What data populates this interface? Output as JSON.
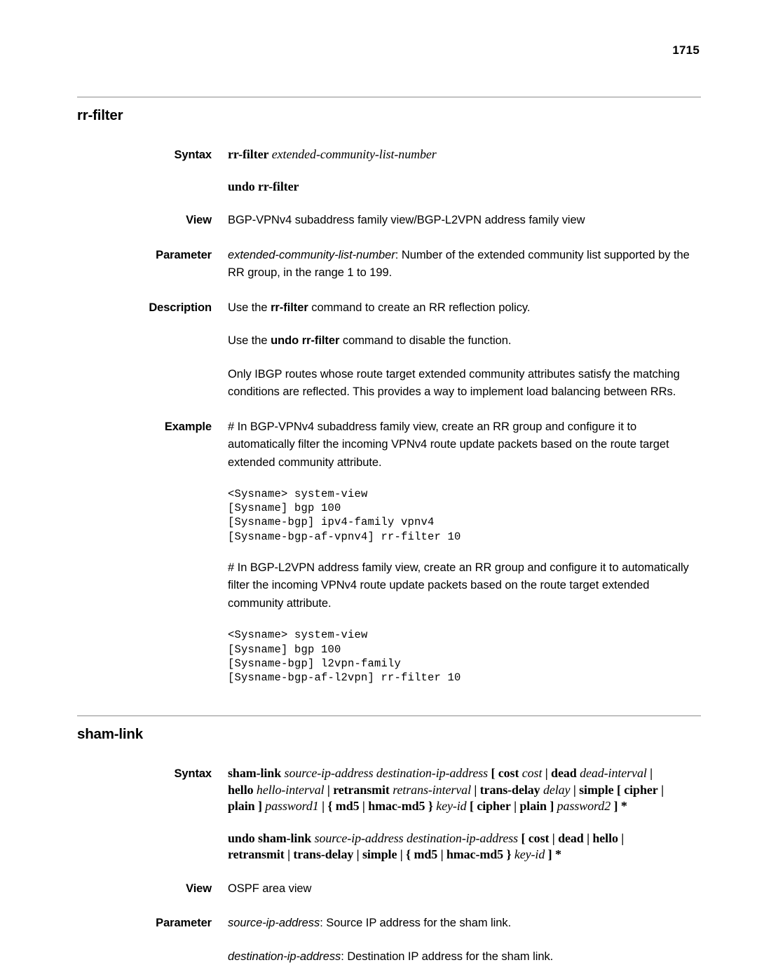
{
  "page": {
    "number": "1715"
  },
  "sections": [
    {
      "id": "rr-filter",
      "title": "rr-filter",
      "rows": [
        {
          "label": "Syntax",
          "syntax_lines": [
            "rr-filter extended-community-list-number",
            "undo rr-filter"
          ]
        },
        {
          "label": "View",
          "text": "BGP-VPNv4 subaddress family view/BGP-L2VPN address family view"
        },
        {
          "label": "Parameter",
          "param_name": "extended-community-list-number",
          "text": ": Number of the extended community list supported by the RR group, in the range 1 to 199."
        },
        {
          "label": "Description",
          "paragraphs": [
            {
              "pre": "Use the ",
              "bold": "rr-filter",
              "post": " command to create an RR reflection policy."
            },
            {
              "pre": "Use the ",
              "bold": "undo rr-filter",
              "post": " command to disable the function."
            },
            {
              "pre": "Only IBGP routes whose route target extended community attributes satisfy the matching conditions are reflected. This provides a way to implement load balancing between RRs.",
              "bold": "",
              "post": ""
            }
          ]
        },
        {
          "label": "Example",
          "example_1_text": "# In BGP-VPNv4 subaddress family view, create an RR group and configure it to automatically filter the incoming VPNv4 route update packets based on the route target extended community attribute.",
          "example_1_code": "<Sysname> system-view\n[Sysname] bgp 100\n[Sysname-bgp] ipv4-family vpnv4\n[Sysname-bgp-af-vpnv4] rr-filter 10",
          "example_2_text": "# In BGP-L2VPN address family view, create an RR group and configure it to automatically filter the incoming VPNv4 route update packets based on the route target extended community attribute.",
          "example_2_code": "<Sysname> system-view\n[Sysname] bgp 100\n[Sysname-bgp] l2vpn-family\n[Sysname-bgp-af-l2vpn] rr-filter 10"
        }
      ]
    },
    {
      "id": "sham-link",
      "title": "sham-link",
      "rows": [
        {
          "label": "Syntax"
        },
        {
          "label": "View",
          "text": "OSPF area view"
        },
        {
          "label": "Parameter",
          "param_1_name": "source-ip-address",
          "param_1_text": ": Source IP address for the sham link.",
          "param_2_name": "destination-ip-address",
          "param_2_text": ": Destination IP address for the sham link."
        }
      ]
    }
  ],
  "labels": {
    "syntax": "Syntax",
    "view": "View",
    "parameter": "Parameter",
    "description": "Description",
    "example": "Example"
  },
  "sham_link_syntax": {
    "cmd": "sham-link",
    "undo_cmd": "undo sham-link",
    "src": "source-ip-address",
    "dst": "destination-ip-address",
    "cost_kw": "cost",
    "cost_var": "cost",
    "dead_kw": "dead",
    "dead_var": "dead-interval",
    "hello_kw": "hello",
    "hello_var": "hello-interval",
    "retransmit_kw": "retransmit",
    "retransmit_var": "retrans-interval",
    "transdelay_kw": "trans-delay",
    "transdelay_var": "delay",
    "simple_kw": "simple",
    "cipher_kw": "cipher",
    "plain_kw": "plain",
    "password1_var": "password1",
    "md5_kw": "md5",
    "hmacmd5_kw": "hmac-md5",
    "keyid_var": "key-id",
    "password2_var": "password2"
  }
}
